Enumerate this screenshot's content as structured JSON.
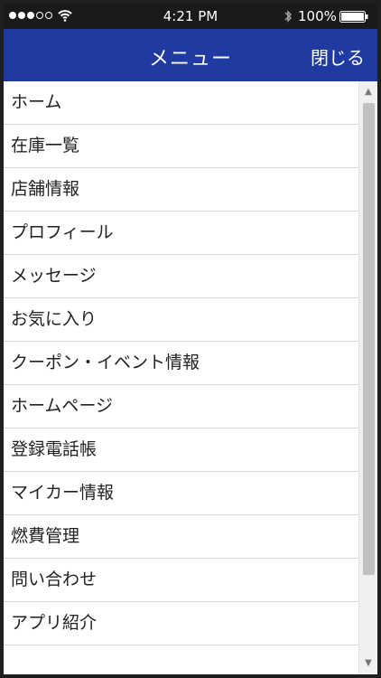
{
  "status_bar": {
    "time": "4:21 PM",
    "battery_percent": "100%",
    "signal_icon": "signal-dots-icon",
    "wifi_icon": "wifi-icon",
    "bluetooth_icon": "bluetooth-icon",
    "battery_icon": "battery-icon"
  },
  "nav": {
    "title": "メニュー",
    "close_label": "閉じる",
    "background_color": "#1f3aa0"
  },
  "menu": {
    "items": [
      {
        "label": "ホーム"
      },
      {
        "label": "在庫一覧"
      },
      {
        "label": "店舗情報"
      },
      {
        "label": "プロフィール"
      },
      {
        "label": "メッセージ"
      },
      {
        "label": "お気に入り"
      },
      {
        "label": "クーポン・イベント情報"
      },
      {
        "label": "ホームページ"
      },
      {
        "label": "登録電話帳"
      },
      {
        "label": "マイカー情報"
      },
      {
        "label": "燃費管理"
      },
      {
        "label": "問い合わせ"
      },
      {
        "label": "アプリ紹介"
      },
      {
        "label": ""
      }
    ]
  },
  "scrollbar": {
    "up_icon": "scroll-up-arrow-icon",
    "down_icon": "scroll-down-arrow-icon"
  }
}
